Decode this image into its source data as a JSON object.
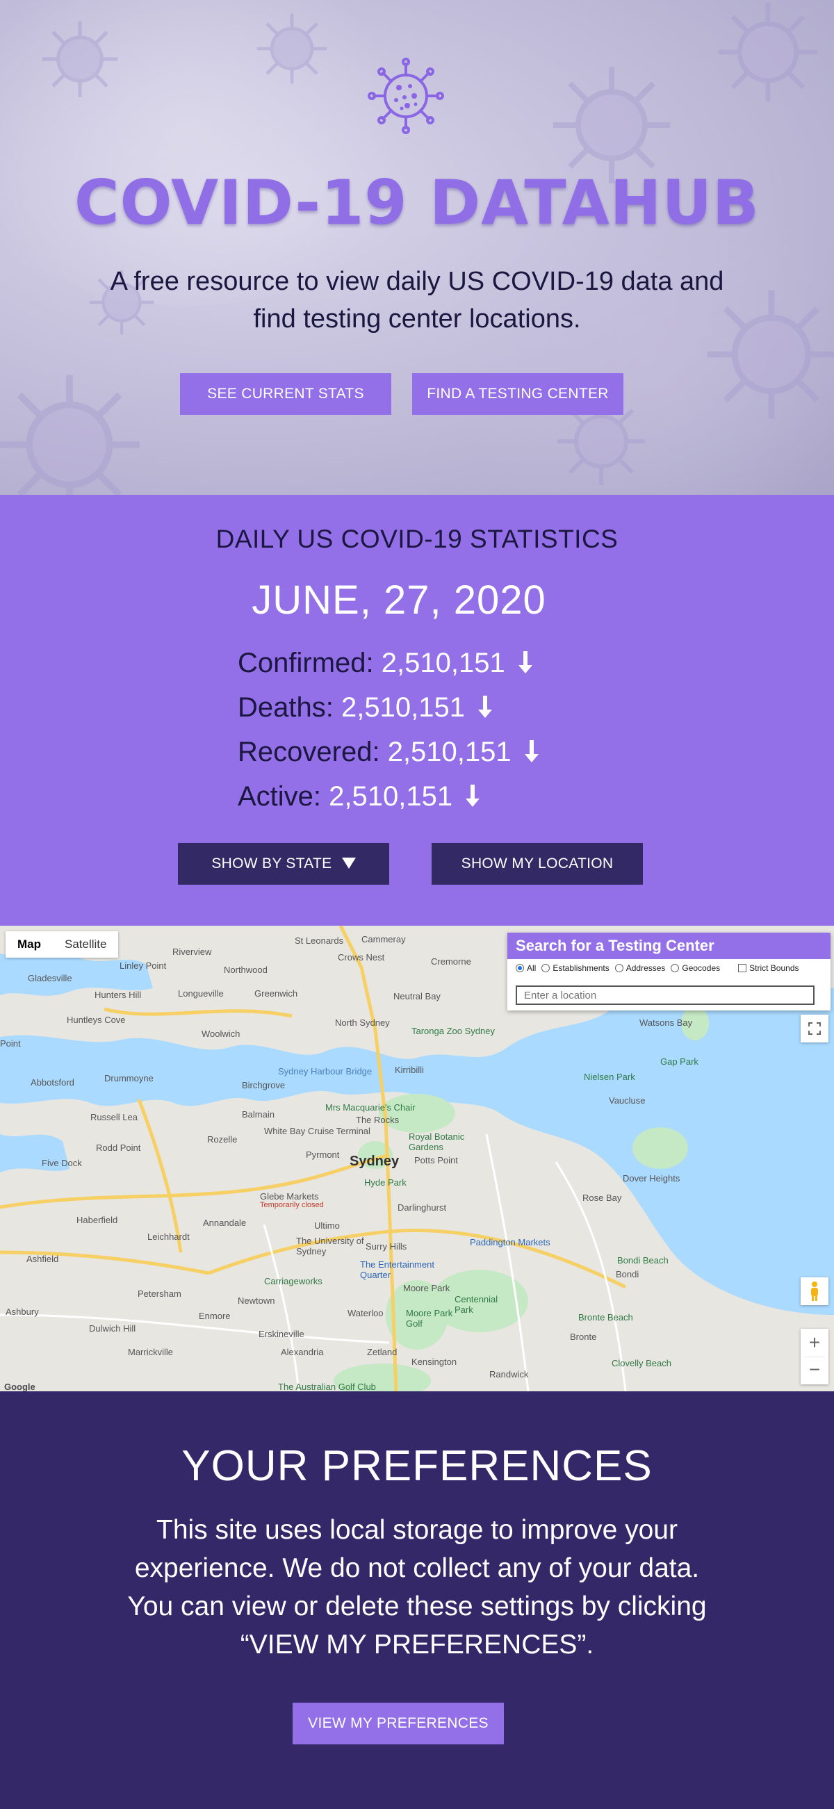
{
  "hero": {
    "title": "COVID-19 DATAHUB",
    "subtitle": "A free resource to view daily US COVID-19 data and find testing center locations.",
    "buttons": {
      "see_stats": "SEE CURRENT STATS",
      "find_center": "FIND A TESTING CENTER"
    }
  },
  "stats": {
    "heading": "DAILY US COVID-19 STATISTICS",
    "date": "JUNE, 27, 2020",
    "rows": [
      {
        "label": "Confirmed:",
        "value": "2,510,151",
        "trend": "down"
      },
      {
        "label": "Deaths:",
        "value": "2,510,151",
        "trend": "down"
      },
      {
        "label": "Recovered:",
        "value": "2,510,151",
        "trend": "down"
      },
      {
        "label": "Active:",
        "value": "2,510,151",
        "trend": "down"
      }
    ],
    "buttons": {
      "show_by_state": "SHOW BY STATE",
      "show_location": "SHOW MY LOCATION"
    }
  },
  "map": {
    "type_control": {
      "map": "Map",
      "satellite": "Satellite",
      "selected": "Map"
    },
    "search": {
      "title": "Search for a Testing Center",
      "options": [
        "All",
        "Establishments",
        "Addresses",
        "Geocodes"
      ],
      "selected_option": "All",
      "strict_bounds": "Strict Bounds",
      "placeholder": "Enter a location"
    },
    "labels": {
      "sydney": "Sydney",
      "riverview": "Riverview",
      "cammeray": "Cammeray",
      "st_leonards": "St Leonards",
      "crows_nest": "Crows Nest",
      "cremorne": "Cremorne",
      "linley_point": "Linley Point",
      "northwood": "Northwood",
      "gladesville": "Gladesville",
      "hunters_hill": "Hunters Hill",
      "longueville": "Longueville",
      "greenwich": "Greenwich",
      "neutral_bay": "Neutral Bay",
      "huntleys_cove": "Huntleys Cove",
      "woolwich": "Woolwich",
      "north_sydney": "North Sydney",
      "taronga_zoo": "Taronga Zoo Sydney",
      "watsons_bay": "Watsons Bay",
      "gap_park": "Gap Park",
      "abbotsford": "Abbotsford",
      "drummoyne": "Drummoyne",
      "birchgrove": "Birchgrove",
      "harbour_bridge": "Sydney Harbour Bridge",
      "kirribilli": "Kirribilli",
      "nielsen_park": "Nielsen Park",
      "vaucluse": "Vaucluse",
      "russell_lea": "Russell Lea",
      "balmain": "Balmain",
      "white_bay": "White Bay Cruise Terminal",
      "mrs_macquaries": "Mrs Macquarie's Chair",
      "the_rocks": "The Rocks",
      "botanic_gardens": "Royal Botanic Gardens",
      "rodd_point": "Rodd Point",
      "rozelle": "Rozelle",
      "pyrmont": "Pyrmont",
      "five_dock": "Five Dock",
      "potts_point": "Potts Point",
      "dover_heights": "Dover Heights",
      "hyde_park": "Hyde Park",
      "glebe_markets": "Glebe Markets",
      "glebe_closed": "Temporarily closed",
      "rose_bay": "Rose Bay",
      "haberfield": "Haberfield",
      "annandale": "Annandale",
      "darlinghurst": "Darlinghurst",
      "ultimo": "Ultimo",
      "leichhardt": "Leichhardt",
      "uni_sydney": "The University of Sydney",
      "surry_hills": "Surry Hills",
      "paddington_markets": "Paddington Markets",
      "ashfield": "Ashfield",
      "entertainment_quarter": "The Entertainment Quarter",
      "bondi_beach": "Bondi Beach",
      "bondi": "Bondi",
      "carriageworks": "Carriageworks",
      "moore_park": "Moore Park",
      "petersham": "Petersham",
      "centennial_park": "Centennial Park",
      "ashbury": "Ashbury",
      "newtown": "Newtown",
      "enmore": "Enmore",
      "waterloo": "Waterloo",
      "moore_park_golf": "Moore Park Golf",
      "bronte_beach": "Bronte Beach",
      "dulwich_hill": "Dulwich Hill",
      "erskineville": "Erskineville",
      "bronte": "Bronte",
      "marrickville": "Marrickville",
      "alexandria": "Alexandria",
      "zetland": "Zetland",
      "kensington": "Kensington",
      "clovelly_beach": "Clovelly Beach",
      "randwick": "Randwick",
      "golf_club": "The Australian Golf Club",
      "google": "Google",
      "point_piper": "Point"
    }
  },
  "prefs": {
    "title": "YOUR PREFERENCES",
    "text": "This site uses local storage to improve your experience. We do not collect any of your data. You can view or delete these settings by clicking “VIEW MY PREFERENCES”.",
    "button": "VIEW MY PREFERENCES"
  },
  "colors": {
    "primary": "#9370e8",
    "dark": "#342868",
    "text_dark": "#1b1740",
    "water": "#aadaff",
    "land": "#e8e6e1",
    "park": "#c5e8c5"
  }
}
